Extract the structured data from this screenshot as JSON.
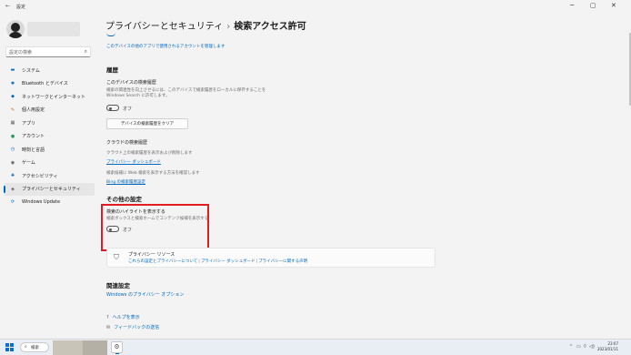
{
  "window": {
    "back_icon": "←",
    "title": "設定",
    "minimize": "─",
    "maximize": "▢",
    "close": "✕"
  },
  "sidebar": {
    "search_placeholder": "設定の検索",
    "search_icon": "⌕",
    "items": [
      {
        "icon": "▬",
        "label": "システム",
        "icon_color": "#0067c0"
      },
      {
        "icon": "✱",
        "label": "Bluetooth とデバイス",
        "icon_color": "#0067c0"
      },
      {
        "icon": "◆",
        "label": "ネットワークとインターネット",
        "icon_color": "#0067c0"
      },
      {
        "icon": "✎",
        "label": "個人用設定",
        "icon_color": "#c76b1c"
      },
      {
        "icon": "▦",
        "label": "アプリ",
        "icon_color": "#555555"
      },
      {
        "icon": "●",
        "label": "アカウント",
        "icon_color": "#2a9d5c"
      },
      {
        "icon": "◷",
        "label": "時刻と言語",
        "icon_color": "#0067c0"
      },
      {
        "icon": "◉",
        "label": "ゲーム",
        "icon_color": "#555555"
      },
      {
        "icon": "✚",
        "label": "アクセシビリティ",
        "icon_color": "#0067c0"
      },
      {
        "icon": "◈",
        "label": "プライバシーとセキュリティ",
        "icon_color": "#555555",
        "active": true
      },
      {
        "icon": "⟳",
        "label": "Windows Update",
        "icon_color": "#0067c0"
      }
    ]
  },
  "header": {
    "parent": "プライバシーとセキュリティ",
    "separator": "›",
    "current": "検索アクセス許可"
  },
  "top_link": "このデバイスの他のアプリで使用されるアカウントを管理します",
  "history": {
    "heading": "履歴",
    "device_title": "このデバイスの検索履歴",
    "device_desc_1": "検索の関連性を向上させるには、このデバイスで検索履歴をローカルに保存することを",
    "device_desc_2": "Windows Search に許可します。",
    "toggle_label": "オフ",
    "clear_button": "デバイスの検索履歴をクリア",
    "cloud_title": "クラウドの検索履歴",
    "cloud_desc": "クラウド上の検索履歴を表示および削除します",
    "cloud_link": "プライバシー ダッシュボード",
    "web_desc": "検索候補に Web 検索を表示する方法を確認します",
    "web_link": "Bing の検索履歴設定"
  },
  "more_settings": {
    "heading": "その他の設定",
    "highlight_title": "検索のハイライトを表示する",
    "highlight_desc": "検索ボックスと検索ホームでコンテンツ候補を表示する",
    "toggle_label": "オフ"
  },
  "privacy_card": {
    "icon": "⛉",
    "title": "プライバシー リソース",
    "links": [
      "これらの設定とプライバシーについて",
      "プライバシー ダッシュボード",
      "プライバシーに関する声明"
    ],
    "link_separator": "|"
  },
  "related": {
    "heading": "関連設定",
    "link": "Windows のプライバシー オプション"
  },
  "help": {
    "help_icon": "?",
    "help_label": "ヘルプを表示",
    "feedback_icon": "✉",
    "feedback_label": "フィードバックの送信"
  },
  "taskbar": {
    "search_icon": "⌕",
    "search_label": "検索",
    "app_icon": "⚙",
    "tray_chevron": "⌃",
    "tray_network": "▭",
    "tray_volume": "◁)",
    "tray_wifi": "⌔",
    "clock_time": "23:07",
    "clock_date": "2023/01/11"
  }
}
